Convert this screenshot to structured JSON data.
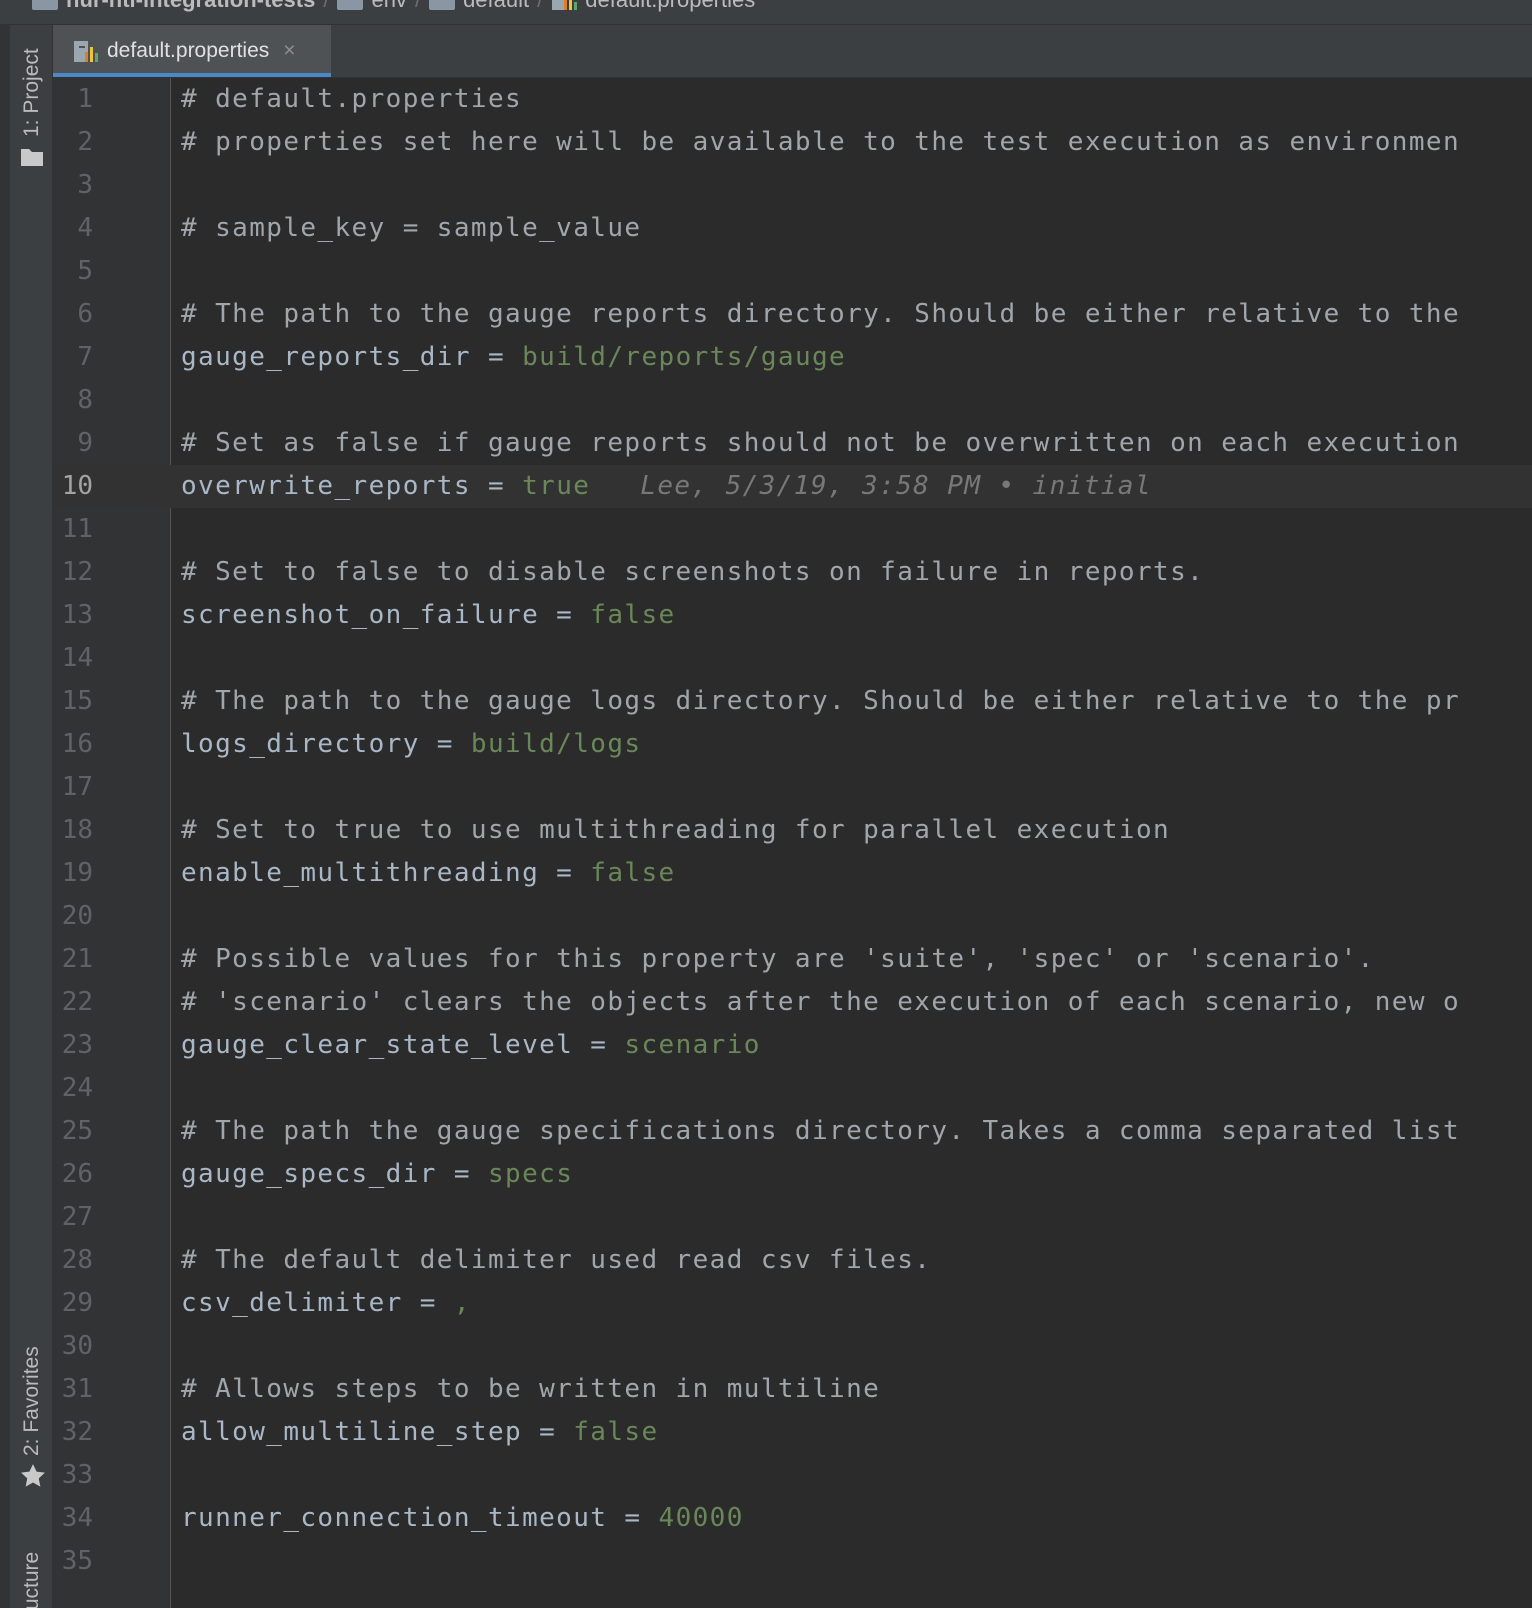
{
  "breadcrumb": {
    "items": [
      "nur-htl-integration-tests",
      "env",
      "default",
      "default.properties"
    ],
    "separator": "/"
  },
  "toolwindows": {
    "project": "1: Project",
    "favorites": "2: Favorites",
    "structure": "Structure"
  },
  "tab": {
    "label": "default.properties",
    "close": "×"
  },
  "editor": {
    "current_line": 10,
    "blame": "Lee, 5/3/19, 3:58 PM • initial",
    "lines": [
      {
        "n": "1",
        "comment": "# default.properties"
      },
      {
        "n": "2",
        "comment": "# properties set here will be available to the test execution as environmen"
      },
      {
        "n": "3"
      },
      {
        "n": "4",
        "comment": "# sample_key = sample_value"
      },
      {
        "n": "5"
      },
      {
        "n": "6",
        "comment": "# The path to the gauge reports directory. Should be either relative to the"
      },
      {
        "n": "7",
        "key": "gauge_reports_dir",
        "val": "build/reports/gauge"
      },
      {
        "n": "8"
      },
      {
        "n": "9",
        "comment": "# Set as false if gauge reports should not be overwritten on each execution"
      },
      {
        "n": "10",
        "key": "overwrite_reports",
        "val": "true"
      },
      {
        "n": "11"
      },
      {
        "n": "12",
        "comment": "# Set to false to disable screenshots on failure in reports."
      },
      {
        "n": "13",
        "key": "screenshot_on_failure",
        "val": "false"
      },
      {
        "n": "14"
      },
      {
        "n": "15",
        "comment": "# The path to the gauge logs directory. Should be either relative to the pr"
      },
      {
        "n": "16",
        "key": "logs_directory",
        "val": "build/logs"
      },
      {
        "n": "17"
      },
      {
        "n": "18",
        "comment": "# Set to true to use multithreading for parallel execution"
      },
      {
        "n": "19",
        "key": "enable_multithreading",
        "val": "false"
      },
      {
        "n": "20"
      },
      {
        "n": "21",
        "comment": "# Possible values for this property are 'suite', 'spec' or 'scenario'."
      },
      {
        "n": "22",
        "comment": "# 'scenario' clears the objects after the execution of each scenario, new o"
      },
      {
        "n": "23",
        "key": "gauge_clear_state_level",
        "val": "scenario"
      },
      {
        "n": "24"
      },
      {
        "n": "25",
        "comment": "# The path the gauge specifications directory. Takes a comma separated list"
      },
      {
        "n": "26",
        "key": "gauge_specs_dir",
        "val": "specs"
      },
      {
        "n": "27"
      },
      {
        "n": "28",
        "comment": "# The default delimiter used read csv files."
      },
      {
        "n": "29",
        "key": "csv_delimiter",
        "val": ","
      },
      {
        "n": "30"
      },
      {
        "n": "31",
        "comment": "# Allows steps to be written in multiline"
      },
      {
        "n": "32",
        "key": "allow_multiline_step",
        "val": "false"
      },
      {
        "n": "33"
      },
      {
        "n": "34",
        "key": "runner_connection_timeout",
        "val": "40000"
      },
      {
        "n": "35"
      }
    ]
  },
  "colors": {
    "background": "#2b2b2b",
    "comment": "#a0a6ac",
    "key": "#a9b7c6",
    "value": "#6a8759",
    "line_number": "#606366",
    "current_line_bg": "#323232",
    "tab_underline": "#4a88c7"
  }
}
